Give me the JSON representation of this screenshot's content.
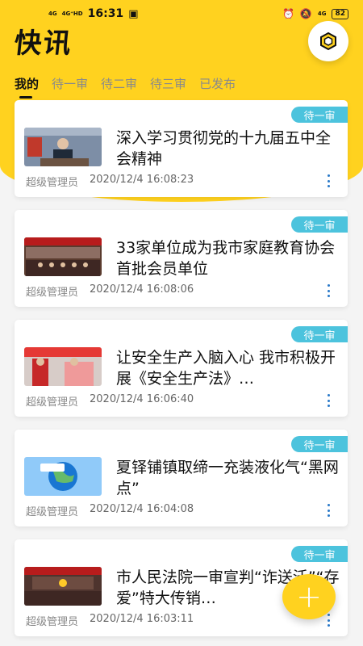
{
  "status_bar": {
    "signal_left": "4G",
    "signal_left_2": "4G⁺HD",
    "time": "16:31",
    "battery": "82",
    "network_right": "4G"
  },
  "page_title": "快讯",
  "tabs": [
    {
      "label": "我的",
      "active": true
    },
    {
      "label": "待一审",
      "active": false
    },
    {
      "label": "待二审",
      "active": false
    },
    {
      "label": "待三审",
      "active": false
    },
    {
      "label": "已发布",
      "active": false
    }
  ],
  "articles": [
    {
      "badge": "待一审",
      "title": "深入学习贯彻党的十九届五中全会精神",
      "author": "超级管理员",
      "datetime": "2020/12/4 16:08:23",
      "thumb": "official-at-desk"
    },
    {
      "badge": "待一审",
      "title": "33家单位成为我市家庭教育协会首批会员单位",
      "author": "超级管理员",
      "datetime": "2020/12/4 16:08:06",
      "thumb": "conference-hall"
    },
    {
      "badge": "待一审",
      "title": "让安全生产入脑入心 我市积极开展《安全生产法》…",
      "author": "超级管理员",
      "datetime": "2020/12/4 16:06:40",
      "thumb": "outdoor-promotion"
    },
    {
      "badge": "待一审",
      "title": "夏铎铺镇取缔一充装液化气“黑网点”",
      "author": "超级管理员",
      "datetime": "2020/12/4 16:04:08",
      "thumb": "environment-globe"
    },
    {
      "badge": "待一审",
      "title": "市人民法院一审宣判“诈送沃”“存爱”特大传销…",
      "author": "超级管理员",
      "datetime": "2020/12/4 16:03:11",
      "thumb": "court-hall"
    }
  ],
  "fab_label": "+",
  "colors": {
    "accent": "#ffd21f",
    "badge": "#4cc3dd",
    "dots": "#2979c9"
  }
}
